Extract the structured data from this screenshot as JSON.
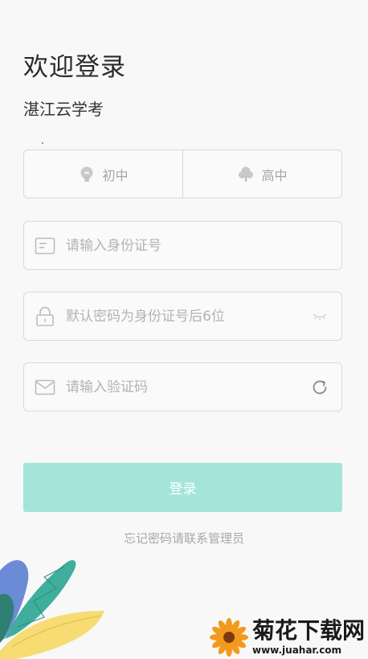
{
  "header": {
    "title": "欢迎登录",
    "subtitle": "湛江云学考"
  },
  "level_selector": {
    "options": [
      {
        "label": "初中",
        "icon": "bulb-icon"
      },
      {
        "label": "高中",
        "icon": "tree-icon"
      }
    ]
  },
  "form": {
    "id_number": {
      "placeholder": "请输入身份证号",
      "value": ""
    },
    "password": {
      "placeholder": "默认密码为身份证号后6位",
      "value": ""
    },
    "captcha": {
      "placeholder": "请输入验证码",
      "value": ""
    },
    "login_label": "登录",
    "forgot_text": "忘记密码请联系管理员"
  },
  "colors": {
    "accent": "#a4e4d9",
    "border": "#d9d9d9",
    "placeholder": "#b3b3b3"
  },
  "watermark": {
    "name": "菊花下载网",
    "url": "www.juahar.com"
  }
}
